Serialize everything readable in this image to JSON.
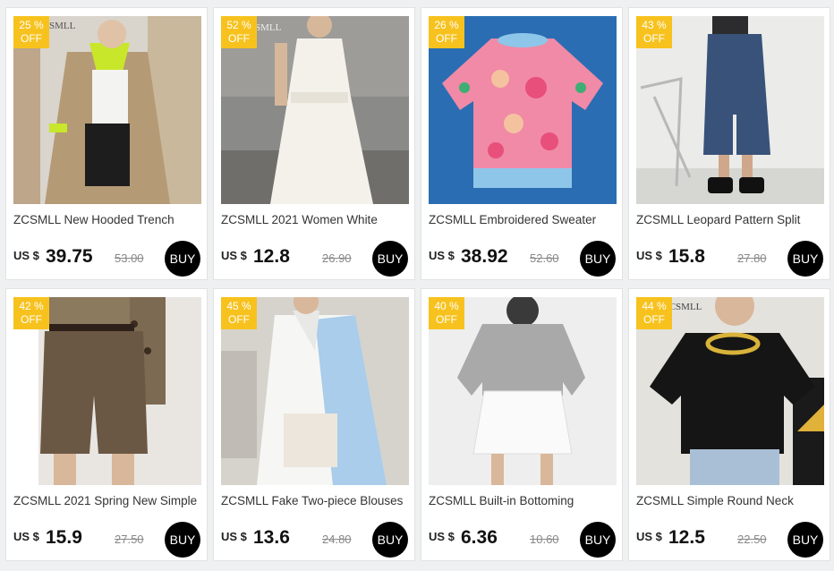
{
  "products": [
    {
      "discount_pct": "25 %",
      "discount_label": "OFF",
      "title": "ZCSMLL New Hooded Trench",
      "currency": "US $",
      "price": "39.75",
      "original_price": "53.00",
      "buy_label": "BUY"
    },
    {
      "discount_pct": "52 %",
      "discount_label": "OFF",
      "title": "ZCSMLL 2021 Women White",
      "currency": "US $",
      "price": "12.8",
      "original_price": "26.90",
      "buy_label": "BUY"
    },
    {
      "discount_pct": "26 %",
      "discount_label": "OFF",
      "title": "ZCSMLL Embroidered Sweater",
      "currency": "US $",
      "price": "38.92",
      "original_price": "52.60",
      "buy_label": "BUY"
    },
    {
      "discount_pct": "43 %",
      "discount_label": "OFF",
      "title": "ZCSMLL Leopard Pattern Split",
      "currency": "US $",
      "price": "15.8",
      "original_price": "27.80",
      "buy_label": "BUY"
    },
    {
      "discount_pct": "42 %",
      "discount_label": "OFF",
      "title": "ZCSMLL 2021 Spring New Simple",
      "currency": "US $",
      "price": "15.9",
      "original_price": "27.50",
      "buy_label": "BUY"
    },
    {
      "discount_pct": "45 %",
      "discount_label": "OFF",
      "title": "ZCSMLL Fake Two-piece Blouses",
      "currency": "US $",
      "price": "13.6",
      "original_price": "24.80",
      "buy_label": "BUY"
    },
    {
      "discount_pct": "40 %",
      "discount_label": "OFF",
      "title": "ZCSMLL Built-in Bottoming",
      "currency": "US $",
      "price": "6.36",
      "original_price": "10.60",
      "buy_label": "BUY"
    },
    {
      "discount_pct": "44 %",
      "discount_label": "OFF",
      "title": "ZCSMLL Simple Round Neck",
      "currency": "US $",
      "price": "12.5",
      "original_price": "22.50",
      "buy_label": "BUY"
    }
  ],
  "colors": {
    "badge": "#f7c21e",
    "buy_button": "#000000",
    "page_background": "#eef0f2"
  }
}
